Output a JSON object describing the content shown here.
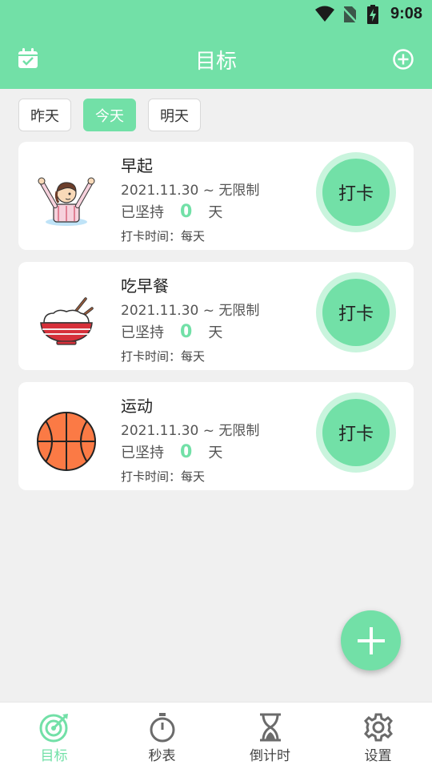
{
  "status_bar": {
    "time": "9:08"
  },
  "header": {
    "title": "目标"
  },
  "day_tabs": [
    {
      "label": "昨天",
      "active": false
    },
    {
      "label": "今天",
      "active": true
    },
    {
      "label": "明天",
      "active": false
    }
  ],
  "goals": [
    {
      "title": "早起",
      "date_range": "2021.11.30 ~ 无限制",
      "streak_prefix": "已坚持",
      "streak_days": "0",
      "streak_unit": "天",
      "checkin_time": "打卡时间：每天",
      "button_label": "打卡",
      "icon": "waking-person-icon"
    },
    {
      "title": "吃早餐",
      "date_range": "2021.11.30 ~ 无限制",
      "streak_prefix": "已坚持",
      "streak_days": "0",
      "streak_unit": "天",
      "checkin_time": "打卡时间：每天",
      "button_label": "打卡",
      "icon": "rice-bowl-icon"
    },
    {
      "title": "运动",
      "date_range": "2021.11.30 ~ 无限制",
      "streak_prefix": "已坚持",
      "streak_days": "0",
      "streak_unit": "天",
      "checkin_time": "打卡时间：每天",
      "button_label": "打卡",
      "icon": "basketball-icon"
    }
  ],
  "bottom_nav": [
    {
      "label": "目标",
      "icon": "target-icon",
      "active": true
    },
    {
      "label": "秒表",
      "icon": "stopwatch-icon",
      "active": false
    },
    {
      "label": "倒计时",
      "icon": "hourglass-icon",
      "active": false
    },
    {
      "label": "设置",
      "icon": "gear-icon",
      "active": false
    }
  ],
  "colors": {
    "accent": "#72e0a7",
    "accent_light": "#c9f4dd",
    "background": "#f0f0f0"
  }
}
